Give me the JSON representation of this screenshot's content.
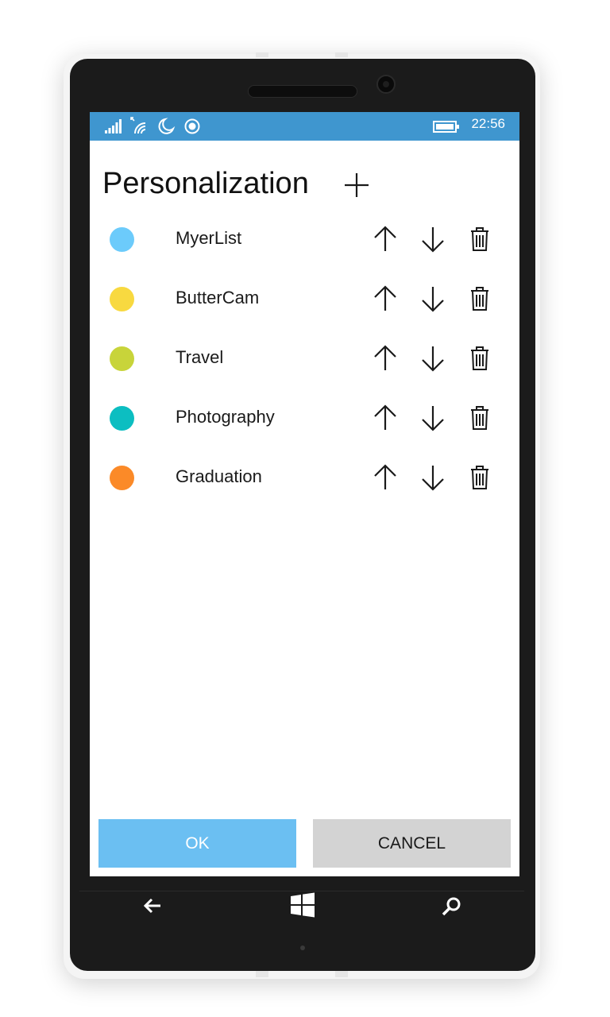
{
  "status_bar": {
    "time": "22:56",
    "icons": [
      "signal-icon",
      "wifi-icon",
      "quiet-hours-icon",
      "location-icon",
      "battery-icon"
    ]
  },
  "header": {
    "title": "Personalization",
    "add_icon": "plus-icon"
  },
  "items": [
    {
      "label": "MyerList",
      "color": "#6ccbfb"
    },
    {
      "label": "ButterCam",
      "color": "#f8d940"
    },
    {
      "label": "Travel",
      "color": "#c8d43a"
    },
    {
      "label": "Photography",
      "color": "#0cbec1"
    },
    {
      "label": "Graduation",
      "color": "#fb8a28"
    }
  ],
  "row_actions": [
    "arrow-up-icon",
    "arrow-down-icon",
    "trash-icon"
  ],
  "footer": {
    "ok_label": "OK",
    "cancel_label": "CANCEL",
    "ok_color": "#6bbff2",
    "cancel_color": "#d3d3d3"
  },
  "nav": {
    "icons": [
      "back-icon",
      "windows-start-icon",
      "search-icon"
    ]
  },
  "theme": {
    "status_bar_color": "#3f96cf",
    "phone_color": "#1b1b1b"
  }
}
